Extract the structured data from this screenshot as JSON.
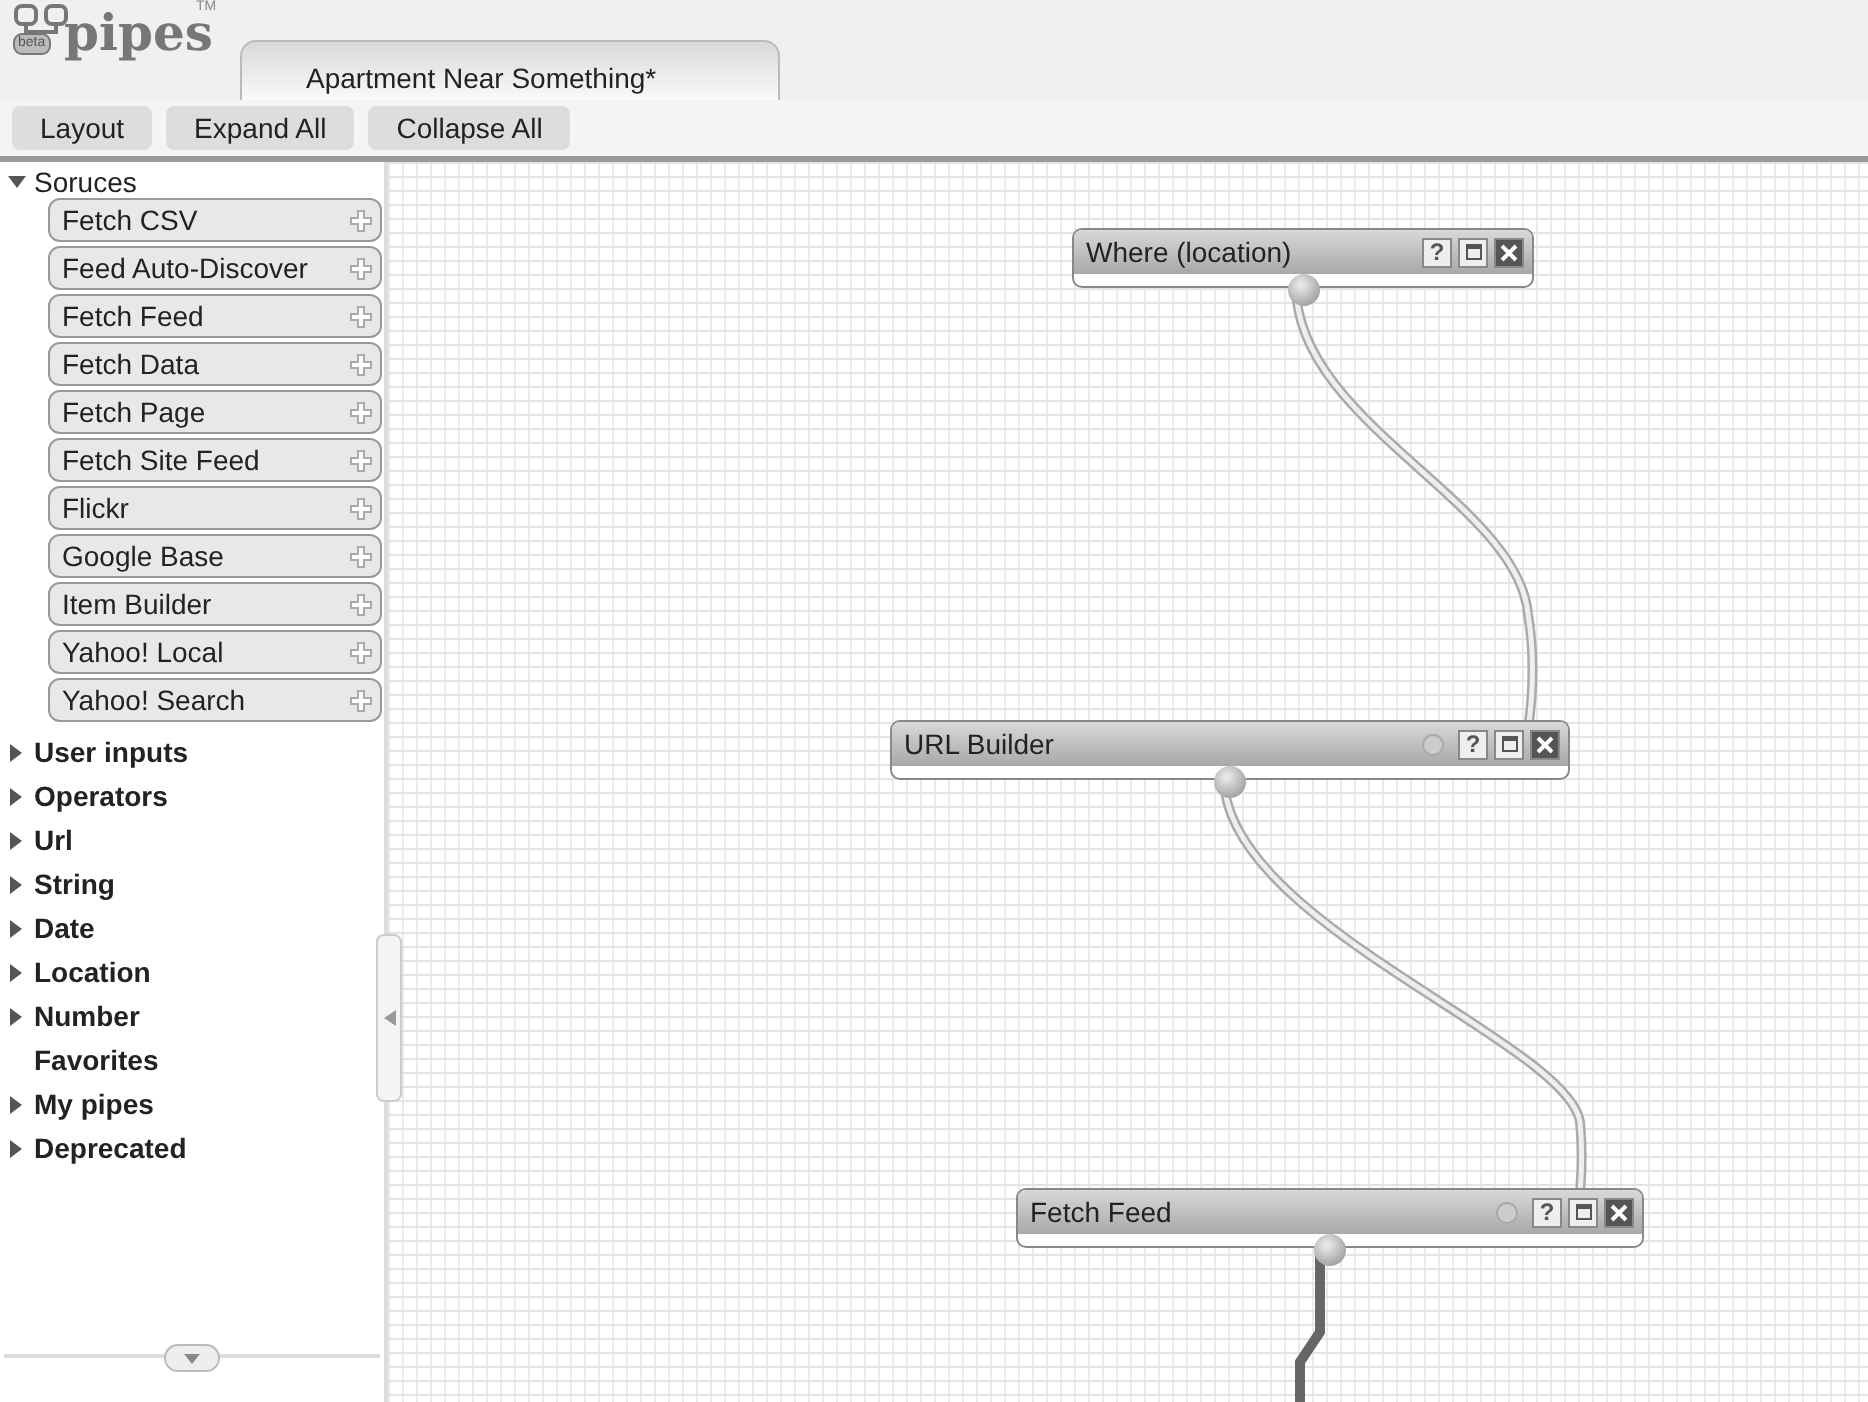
{
  "logo": {
    "badge": "beta",
    "name": "pipes",
    "trademark": "TM"
  },
  "tabs": [
    {
      "label": "Apartment Near Something*",
      "selected": true
    }
  ],
  "toolbar": [
    "Layout",
    "Expand All",
    "Collapse All"
  ],
  "library": [
    {
      "label": "Soruces",
      "kind": "folder",
      "expanded": true,
      "children": [
        {
          "label": "Fetch CSV"
        },
        {
          "label": "Feed Auto-Discover"
        },
        {
          "label": "Fetch Feed"
        },
        {
          "label": "Fetch Data"
        },
        {
          "label": "Fetch Page"
        },
        {
          "label": "Fetch Site Feed"
        },
        {
          "label": "Flickr"
        },
        {
          "label": "Google Base"
        },
        {
          "label": "Item Builder"
        },
        {
          "label": "Yahoo! Local"
        },
        {
          "label": "Yahoo! Search"
        }
      ]
    },
    {
      "label": "User inputs",
      "kind": "folder",
      "expanded": false
    },
    {
      "label": "Operators",
      "kind": "folder",
      "expanded": false
    },
    {
      "label": "Url",
      "kind": "folder",
      "expanded": false
    },
    {
      "label": "String",
      "kind": "folder",
      "expanded": false
    },
    {
      "label": "Date",
      "kind": "folder",
      "expanded": false
    },
    {
      "label": "Location",
      "kind": "folder",
      "expanded": false
    },
    {
      "label": "Number",
      "kind": "folder",
      "expanded": false
    },
    {
      "label": "Favorites",
      "kind": "leaf"
    },
    {
      "label": "My pipes",
      "kind": "folder",
      "expanded": false
    },
    {
      "label": "Deprecated",
      "kind": "folder",
      "expanded": false
    }
  ],
  "modules": [
    {
      "title": "Where (location)",
      "help": "?",
      "status_dot": false
    },
    {
      "title": "URL Builder",
      "help": "?",
      "status_dot": true
    },
    {
      "title": "Fetch Feed",
      "help": "?",
      "status_dot": true
    }
  ]
}
